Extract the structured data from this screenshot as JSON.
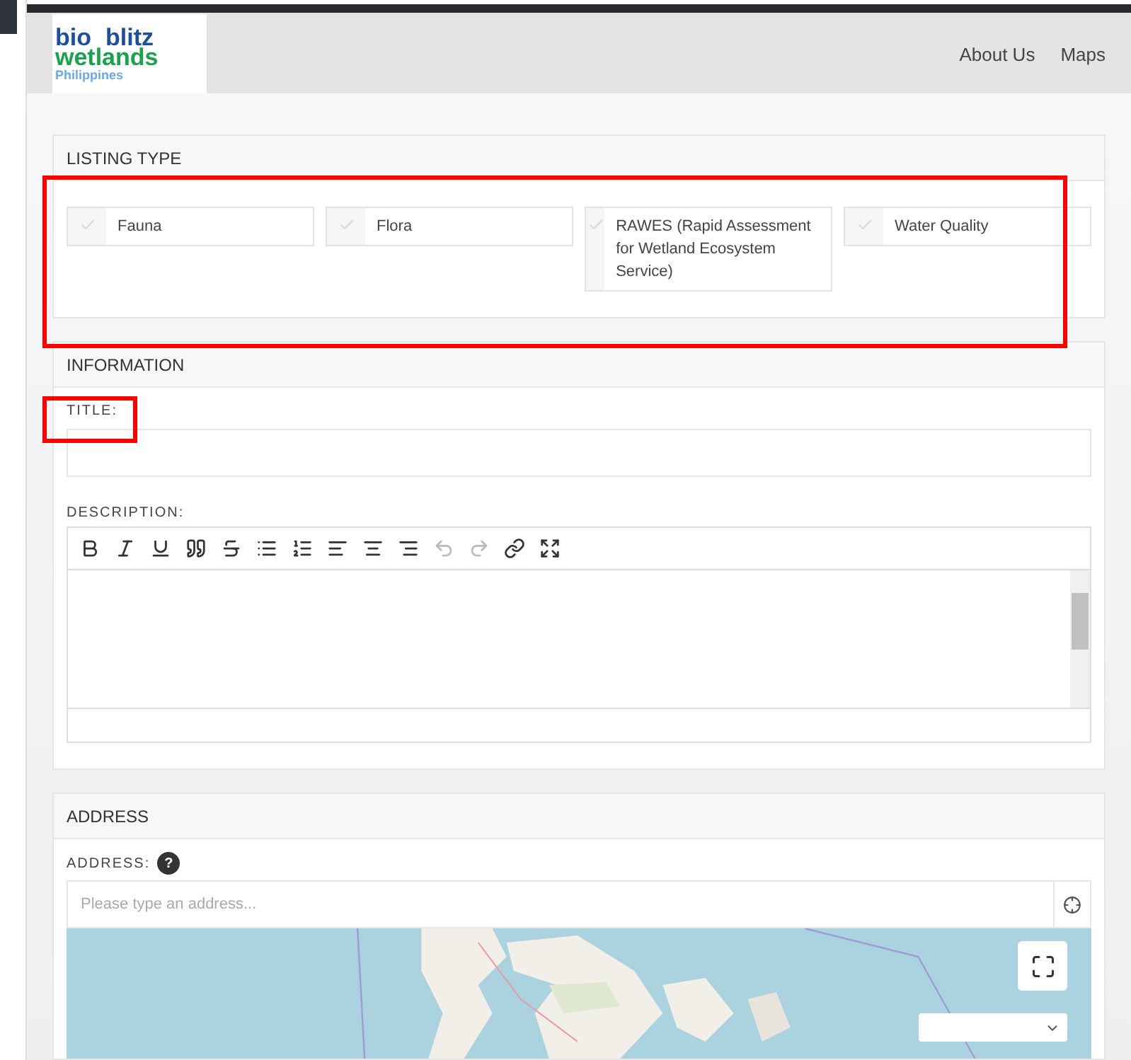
{
  "logo": {
    "line_1": "bio",
    "line_1b": "blitz",
    "line_2": "wetlands",
    "line_3": "Philippines"
  },
  "nav": [
    "About Us",
    "Maps"
  ],
  "listing_type": {
    "heading": "LISTING TYPE",
    "options": [
      {
        "label": "Fauna",
        "checked": false
      },
      {
        "label": "Flora",
        "checked": false
      },
      {
        "label": "RAWES (Rapid Assessment for Wetland Ecosystem Service)",
        "checked": false
      },
      {
        "label": "Water Quality",
        "checked": false
      }
    ]
  },
  "information": {
    "heading": "INFORMATION",
    "title_label": "TITLE:",
    "description_label": "DESCRIPTION:",
    "toolbar": [
      {
        "kind": "bold",
        "disabled": false
      },
      {
        "kind": "italic",
        "disabled": false
      },
      {
        "kind": "underline",
        "disabled": false
      },
      {
        "kind": "quote",
        "disabled": false
      },
      {
        "kind": "strike",
        "disabled": false
      },
      {
        "kind": "bullets",
        "disabled": false
      },
      {
        "kind": "numbers",
        "disabled": false
      },
      {
        "kind": "left",
        "disabled": false
      },
      {
        "kind": "center",
        "disabled": false
      },
      {
        "kind": "right",
        "disabled": false
      },
      {
        "kind": "undo",
        "disabled": true
      },
      {
        "kind": "redo",
        "disabled": true
      },
      {
        "kind": "link",
        "disabled": false
      },
      {
        "kind": "fullscreen",
        "disabled": false
      }
    ]
  },
  "address": {
    "heading": "ADDRESS",
    "label": "ADDRESS:",
    "help": "?",
    "placeholder": "Please type an address..."
  }
}
